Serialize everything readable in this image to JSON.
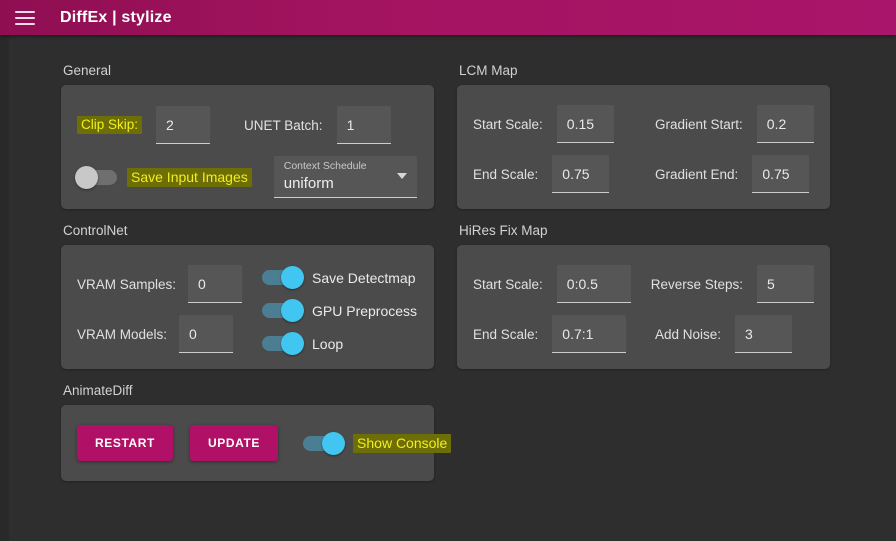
{
  "header": {
    "menu_icon": "hamburger-icon",
    "title": "DiffEx | stylize"
  },
  "colors": {
    "accent": "#b01066",
    "header_bg": "#9e1058",
    "page_bg": "#2e2e2e",
    "card_bg": "#4b4b4b",
    "switch_on": "#41c6f2",
    "highlight_bg": "#6e6e06",
    "highlight_text": "#f2ef1c"
  },
  "sections": {
    "general": {
      "title": "General",
      "clip_skip": {
        "label": "Clip Skip:",
        "value": "2",
        "highlighted": true
      },
      "unet_batch": {
        "label": "UNET Batch:",
        "value": "1",
        "highlighted": false
      },
      "save_input_images": {
        "label": "Save Input Images",
        "state": "off",
        "highlighted": true
      },
      "context_schedule": {
        "label": "Context Schedule",
        "value": "uniform"
      }
    },
    "lcm_map": {
      "title": "LCM Map",
      "fields": [
        {
          "label": "Start Scale:",
          "value": "0.15"
        },
        {
          "label": "Gradient Start:",
          "value": "0.2"
        },
        {
          "label": "End Scale:",
          "value": "0.75"
        },
        {
          "label": "Gradient End:",
          "value": "0.75"
        }
      ]
    },
    "controlnet": {
      "title": "ControlNet",
      "vram_samples": {
        "label": "VRAM Samples:",
        "value": "0"
      },
      "vram_models": {
        "label": "VRAM Models:",
        "value": "0"
      },
      "toggles": [
        {
          "label": "Save Detectmap",
          "state": "on"
        },
        {
          "label": "GPU Preprocess",
          "state": "on"
        },
        {
          "label": "Loop",
          "state": "on"
        }
      ]
    },
    "hires_fix_map": {
      "title": "HiRes Fix Map",
      "fields": [
        {
          "label": "Start Scale:",
          "value": "0:0.5"
        },
        {
          "label": "Reverse Steps:",
          "value": "5"
        },
        {
          "label": "End Scale:",
          "value": "0.7:1"
        },
        {
          "label": "Add Noise:",
          "value": "3"
        }
      ]
    },
    "animatediff": {
      "title": "AnimateDiff",
      "restart_label": "RESTART",
      "update_label": "UPDATE",
      "show_console": {
        "label": "Show Console",
        "state": "on",
        "highlighted": true
      }
    }
  }
}
